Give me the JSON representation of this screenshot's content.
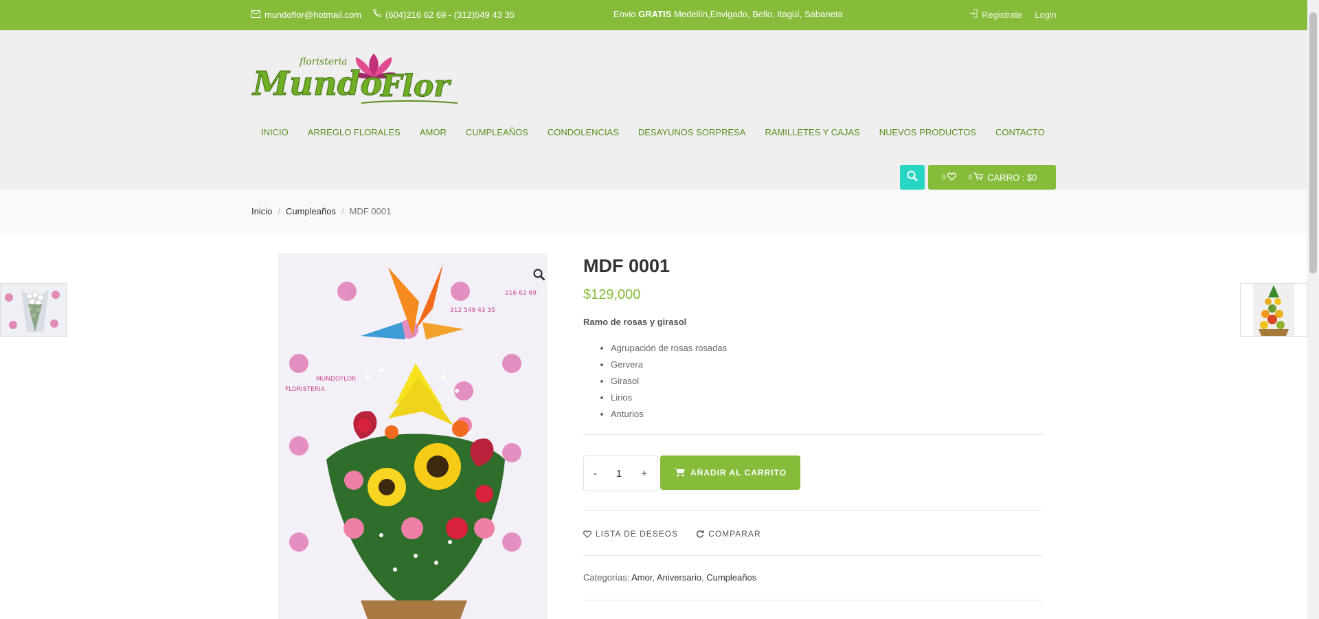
{
  "topbar": {
    "email": "mundoflor@hotmail.com",
    "phones": "(604)216 62 69 - (312)549 43 35",
    "shipping_prefix": "Envio",
    "shipping_bold": "GRATIS",
    "shipping_suffix": "Medellín,Envigado, Bello, Itagüí, Sabaneta",
    "register": "Registrate",
    "login": "Login"
  },
  "logo": {
    "line1": "floristeria",
    "line2": "Mundo",
    "line3": "Flor"
  },
  "nav": [
    "INICIO",
    "ARREGLO FLORALES",
    "AMOR",
    "CUMPLEAÑOS",
    "CONDOLENCIAS",
    "DESAYUNOS SORPRESA",
    "RAMILLETES Y CAJAS",
    "NUEVOS PRODUCTOS",
    "CONTACTO"
  ],
  "cart": {
    "wishlist_count": "0",
    "cart_count": "0",
    "label": "CARRO : $0"
  },
  "breadcrumb": {
    "home": "Inicio",
    "category": "Cumpleaños",
    "current": "MDF 0001"
  },
  "product": {
    "title": "MDF 0001",
    "price": "$129,000",
    "subtitle": "Ramo de rosas y girasol",
    "features": [
      "Agrupación de rosas rosadas",
      "Gervera",
      "Girasol",
      "Lirios",
      "Anturios"
    ],
    "quantity": "1",
    "qty_minus": "-",
    "qty_plus": "+",
    "add_to_cart": "AÑADIR AL CARRITO",
    "wishlist": "LISTA DE DESEOS",
    "compare": "COMPARAR",
    "categories_label": "Categorías:",
    "categories": [
      "Amor",
      "Aniversario",
      "Cumpleaños"
    ]
  },
  "colors": {
    "brand_green": "#87bb3a",
    "search_teal": "#26d5c2",
    "header_bg": "#efefef"
  },
  "icons": [
    "mail-icon",
    "phone-icon",
    "login-icon",
    "search-icon",
    "heart-icon",
    "cart-icon",
    "zoom-icon",
    "refresh-icon"
  ]
}
